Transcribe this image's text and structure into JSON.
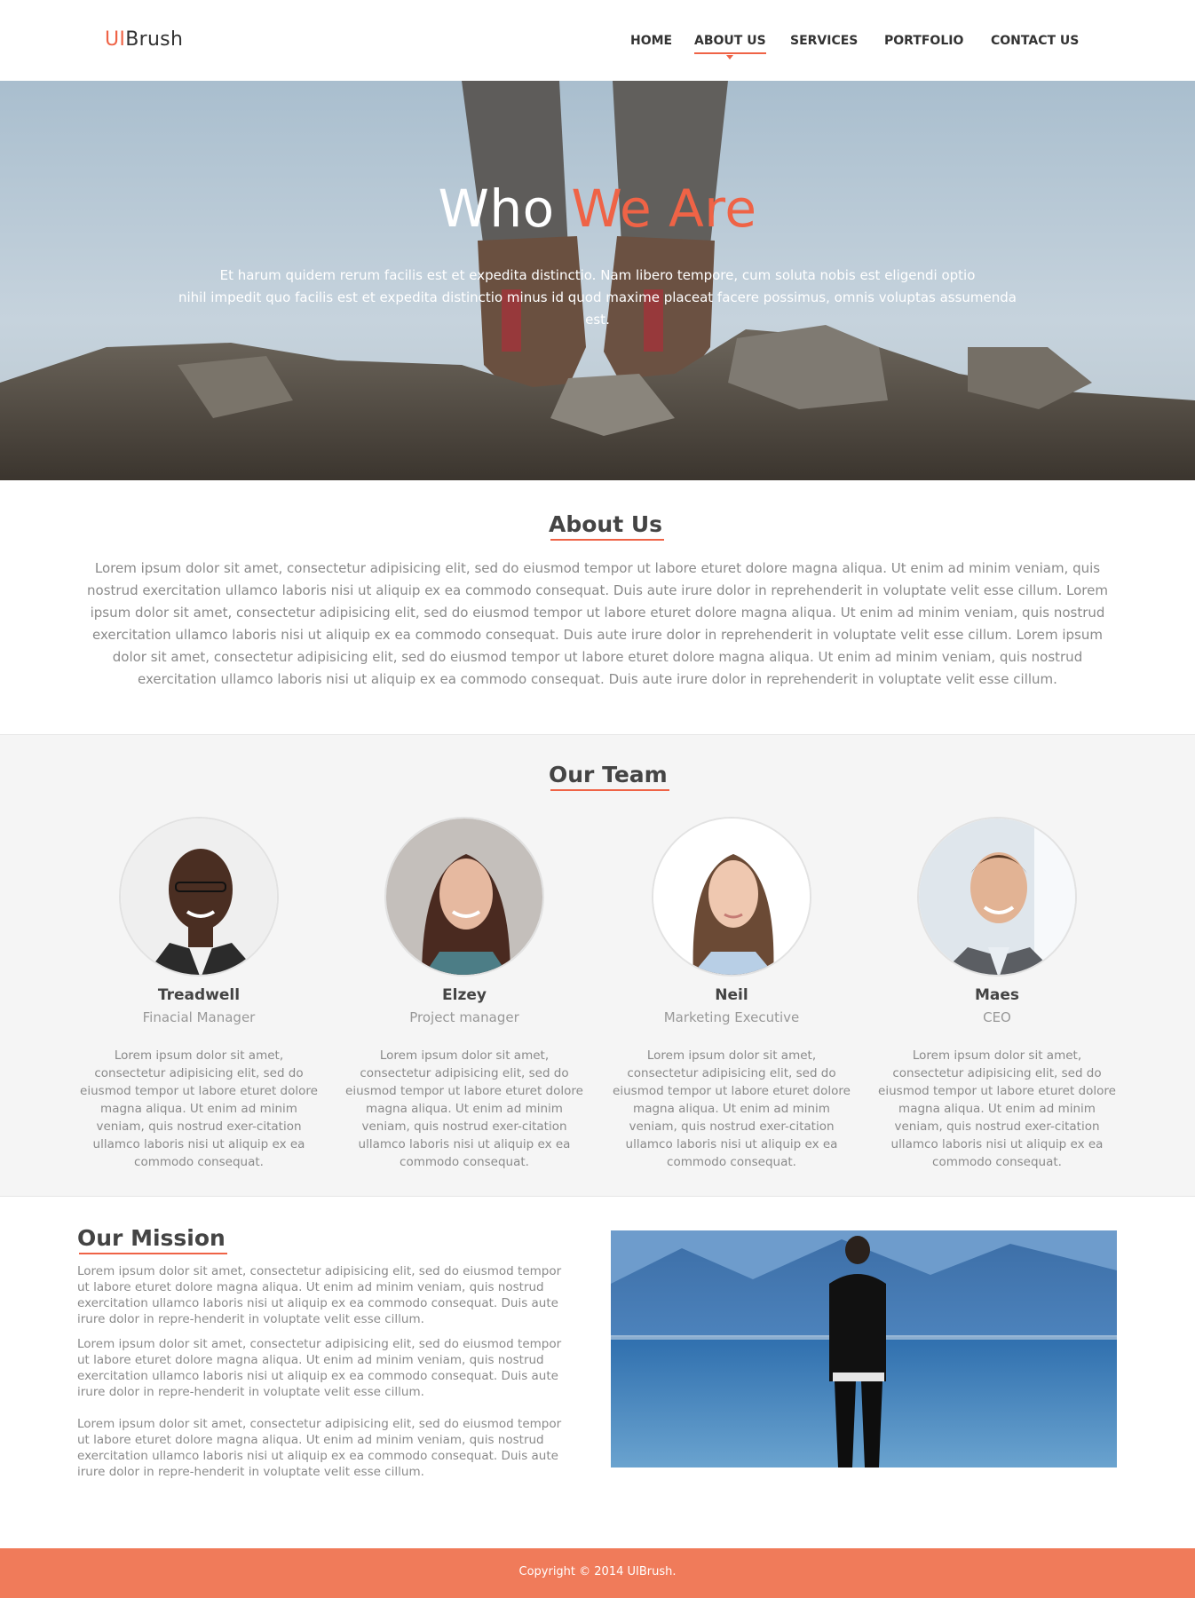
{
  "header": {
    "logo_part1": "UI",
    "logo_part2": "Brush",
    "nav": [
      {
        "label": "HOME"
      },
      {
        "label": "ABOUT US"
      },
      {
        "label": "SERVICES"
      },
      {
        "label": "PORTFOLIO"
      },
      {
        "label": "CONTACT US"
      }
    ],
    "active_nav": "ABOUT US"
  },
  "hero": {
    "title_part1": "Who ",
    "title_part2": "We Are",
    "subtitle_line1": "Et harum quidem rerum facilis est et expedita distinctio. Nam libero tempore, cum soluta nobis est eligendi optio",
    "subtitle_line2": "nihil impedit quo facilis est et expedita distinctio minus id quod maxime placeat facere possimus, omnis voluptas assumenda est."
  },
  "about": {
    "title": "About Us",
    "text": "Lorem ipsum dolor sit amet, consectetur adipisicing elit, sed do eiusmod tempor  ut labore eturet dolore magna aliqua. Ut enim ad minim veniam, quis nostrud exercitation ullamco laboris nisi ut aliquip ex ea commodo consequat. Duis aute irure dolor in reprehenderit in voluptate velit esse cillum.  Lorem ipsum dolor sit amet, consectetur adipisicing elit, sed do eiusmod tempor  ut labore eturet dolore magna aliqua. Ut enim ad minim veniam, quis nostrud exercitation ullamco laboris nisi ut aliquip ex ea commodo consequat. Duis aute irure dolor in reprehenderit in voluptate velit esse cillum. Lorem ipsum dolor sit amet, consectetur adipisicing elit, sed do eiusmod tempor  ut labore eturet dolore magna aliqua. Ut enim ad minim veniam, quis nostrud exercitation ullamco laboris nisi ut aliquip ex ea commodo consequat. Duis aute irure dolor in reprehenderit in voluptate velit esse cillum."
  },
  "team": {
    "title": "Our Team",
    "members": [
      {
        "name": "Treadwell",
        "role": "Finacial Manager",
        "bio": "Lorem ipsum dolor sit amet, consectetur adipisicing elit, sed do eiusmod tempor  ut labore eturet dolore magna aliqua. Ut enim ad minim veniam, quis nostrud exer-citation ullamco laboris nisi ut aliquip ex ea commodo consequat."
      },
      {
        "name": "Elzey",
        "role": "Project manager",
        "bio": "Lorem ipsum dolor sit amet, consectetur adipisicing elit, sed do eiusmod tempor  ut labore eturet dolore magna aliqua. Ut enim ad minim veniam, quis nostrud exer-citation ullamco laboris nisi ut aliquip ex ea commodo consequat."
      },
      {
        "name": "Neil",
        "role": "Marketing Executive",
        "bio": "Lorem ipsum dolor sit amet, consectetur adipisicing elit, sed do eiusmod tempor  ut labore eturet dolore magna aliqua. Ut enim ad minim veniam, quis nostrud exer-citation ullamco laboris nisi ut aliquip ex ea commodo consequat."
      },
      {
        "name": "Maes",
        "role": "CEO",
        "bio": "Lorem ipsum dolor sit amet, consectetur adipisicing elit, sed do eiusmod tempor  ut labore eturet dolore magna aliqua. Ut enim ad minim veniam, quis nostrud exer-citation ullamco laboris nisi ut aliquip ex ea commodo consequat."
      }
    ]
  },
  "mission": {
    "title": "Our Mission",
    "paragraphs": [
      "Lorem ipsum dolor sit amet, consectetur adipisicing elit, sed do eiusmod tempor  ut labore eturet dolore magna aliqua. Ut enim ad minim veniam, quis nostrud exercitation ullamco laboris nisi ut aliquip ex ea commodo consequat. Duis aute irure dolor in repre-henderit in voluptate velit esse cillum.",
      "Lorem ipsum dolor sit amet, consectetur adipisicing elit, sed do eiusmod tempor  ut labore eturet dolore magna aliqua. Ut enim ad minim veniam, quis nostrud exercitation ullamco laboris nisi ut aliquip ex ea commodo consequat. Duis aute irure dolor in repre-henderit in voluptate velit esse cillum.",
      "Lorem ipsum dolor sit amet, consectetur adipisicing elit, sed do eiusmod tempor  ut labore eturet dolore magna aliqua. Ut enim ad minim veniam, quis nostrud exercitation ullamco laboris nisi ut aliquip ex ea commodo consequat. Duis aute irure dolor in repre-henderit in voluptate velit esse cillum."
    ]
  },
  "footer": {
    "copyright": "Copyright © 2014 UIBrush."
  },
  "colors": {
    "accent": "#ef6346",
    "footer": "#f07b5a",
    "text_muted": "#8a8a8a",
    "section_bg": "#f5f5f5"
  }
}
